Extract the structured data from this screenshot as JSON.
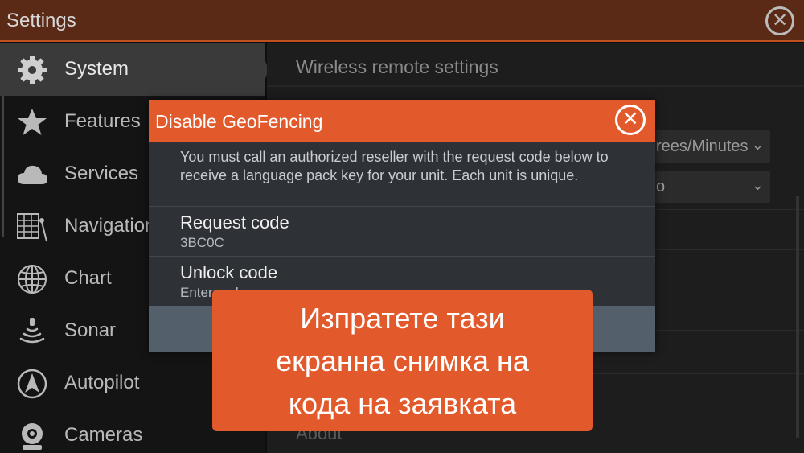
{
  "window": {
    "title": "Settings"
  },
  "sidebar": {
    "items": [
      {
        "label": "System",
        "icon": "gear-icon"
      },
      {
        "label": "Features",
        "icon": "star-icon"
      },
      {
        "label": "Services",
        "icon": "cloud-icon"
      },
      {
        "label": "Navigation",
        "icon": "navigation-icon"
      },
      {
        "label": "Chart",
        "icon": "globe-icon"
      },
      {
        "label": "Sonar",
        "icon": "sonar-icon"
      },
      {
        "label": "Autopilot",
        "icon": "autopilot-icon"
      },
      {
        "label": "Cameras",
        "icon": "camera-icon"
      }
    ]
  },
  "main": {
    "heading": "Wireless remote settings",
    "select1_value": "rees/Minutes",
    "select2_value": "o",
    "about_label": "About"
  },
  "dialog": {
    "title": "Disable GeoFencing",
    "message": "You must call an authorized reseller with the request code below to receive a language pack key for your unit.  Each unit is unique.",
    "request_label": "Request code",
    "request_value": "3BC0C",
    "unlock_label": "Unlock code",
    "unlock_placeholder": "Enter code"
  },
  "banner": {
    "line1": "Изпратете тази",
    "line2": "екранна снимка на",
    "line3": "кода на заявката"
  },
  "colors": {
    "accent": "#e2592b",
    "dialog_bg": "#2e3136",
    "footer": "#53606c"
  }
}
